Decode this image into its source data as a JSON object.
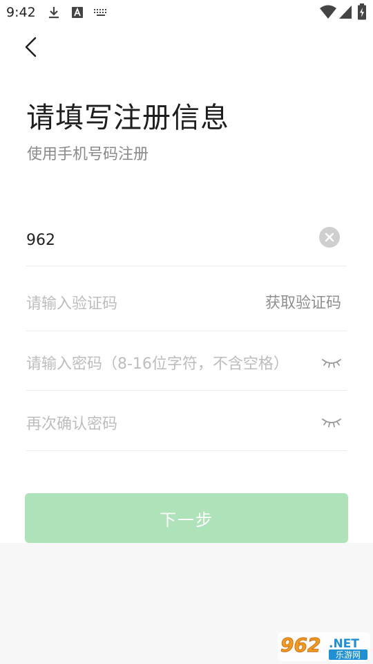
{
  "status_bar": {
    "time": "9:42",
    "left_icons": [
      "download-icon",
      "font-a-icon",
      "keyboard-icon"
    ],
    "right_icons": [
      "wifi-icon",
      "signal-icon",
      "battery-charging-icon"
    ]
  },
  "header": {
    "back_icon": "chevron-left-icon",
    "title": "请填写注册信息",
    "subtitle": "使用手机号码注册"
  },
  "form": {
    "phone": {
      "value": "962",
      "clear_icon": "clear-icon"
    },
    "code": {
      "placeholder": "请输入验证码",
      "get_code_label": "获取验证码"
    },
    "password": {
      "placeholder": "请输入密码（8-16位字符，不含空格）",
      "toggle_icon": "eye-closed-icon"
    },
    "confirm": {
      "placeholder": "再次确认密码",
      "toggle_icon": "eye-closed-icon"
    }
  },
  "actions": {
    "next_label": "下一步"
  },
  "watermark": {
    "number": "962",
    "suffix": ".NET",
    "caption": "乐游网"
  },
  "colors": {
    "primary_disabled": "#aee2b8",
    "text_dark": "#1e1e1e",
    "placeholder": "#bdbdbd"
  }
}
